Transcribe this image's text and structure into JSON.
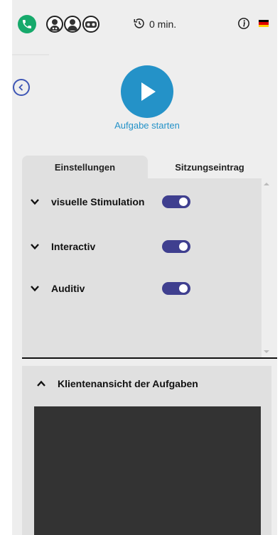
{
  "header": {
    "timer_value": "0 min.",
    "icons": [
      "phone-icon",
      "client-avatar-icon",
      "user-avatar-icon",
      "vr-headset-icon",
      "timer-icon",
      "info-icon",
      "german-flag-icon"
    ]
  },
  "start": {
    "label": "Aufgabe starten"
  },
  "tabs": [
    {
      "label": "Einstellungen",
      "active": true
    },
    {
      "label": "Sitzungseintrag",
      "active": false
    }
  ],
  "settings": [
    {
      "label": "visuelle Stimulation",
      "enabled": true
    },
    {
      "label": "Interactiv",
      "enabled": true
    },
    {
      "label": "Auditiv",
      "enabled": true
    }
  ],
  "client_view": {
    "title": "Klientenansicht der Aufgaben",
    "expanded": true
  },
  "colors": {
    "accent": "#2492c8",
    "toggle": "#3f3f8f",
    "phone": "#16a96b",
    "back": "#3e56b5",
    "panel": "#e0e0e0",
    "background": "#eeeeee",
    "preview": "#333333"
  }
}
